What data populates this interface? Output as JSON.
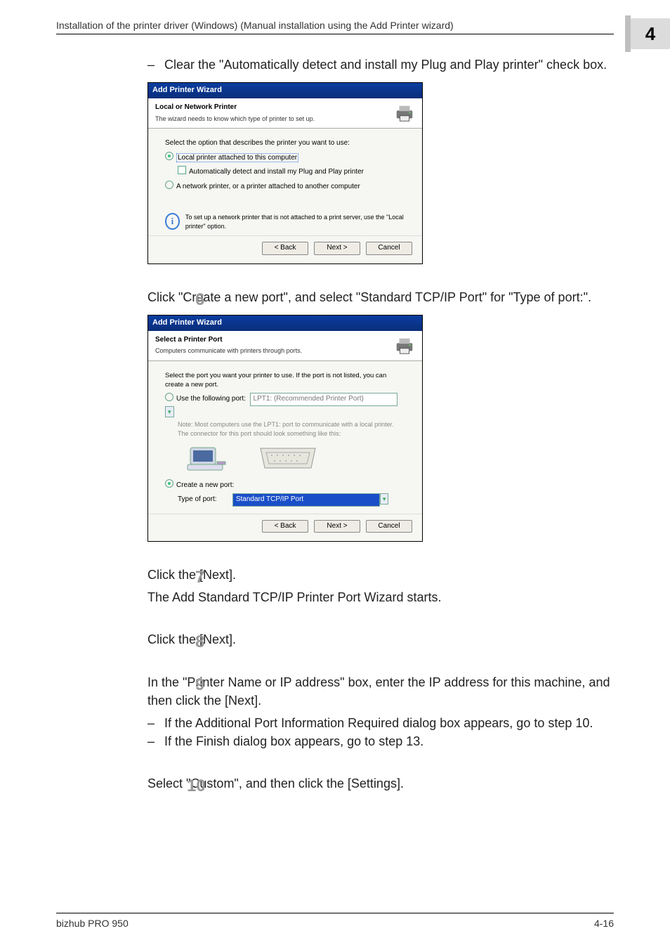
{
  "header": {
    "section_title": "Installation of the printer driver (Windows) (Manual installation using the Add Printer wizard)",
    "chapter_number": "4"
  },
  "step5": {
    "dash_text": "Clear the \"Automatically detect and install my Plug and Play printer\" check box."
  },
  "dlg1": {
    "window_title": "Add Printer Wizard",
    "heading": "Local or Network Printer",
    "subheading": "The wizard needs to know which type of printer to set up.",
    "prompt": "Select the option that describes the printer you want to use:",
    "opt_local": "Local printer attached to this computer",
    "chk_auto": "Automatically detect and install my Plug and Play printer",
    "opt_network": "A network printer, or a printer attached to another computer",
    "info_text": "To set up a network printer that is not attached to a print server, use the \"Local printer\" option.",
    "btn_back": "< Back",
    "btn_next": "Next >",
    "btn_cancel": "Cancel"
  },
  "step6": {
    "num": "6",
    "text": "Click \"Create a new port\", and select \"Standard TCP/IP Port\" for \"Type of port:\"."
  },
  "dlg2": {
    "window_title": "Add Printer Wizard",
    "heading": "Select a Printer Port",
    "subheading": "Computers communicate with printers through ports.",
    "prompt": "Select the port you want your printer to use.  If the port is not listed, you can create a new port.",
    "opt_use": "Use the following port:",
    "use_value": "LPT1: (Recommended Printer Port)",
    "note": "Note: Most computers use the LPT1: port to communicate with a local printer. The connector for this port should look something like this:",
    "opt_create": "Create a new port:",
    "type_label": "Type of port:",
    "type_value": "Standard TCP/IP Port",
    "btn_back": "< Back",
    "btn_next": "Next >",
    "btn_cancel": "Cancel"
  },
  "step7": {
    "num": "7",
    "text1": "Click the [Next].",
    "text2": "The Add Standard TCP/IP Printer Port Wizard starts."
  },
  "step8": {
    "num": "8",
    "text": "Click the [Next]."
  },
  "step9": {
    "num": "9",
    "text": "In the \"Printer Name or IP address\" box, enter the IP address for this machine, and then click the [Next].",
    "dash1": "If the Additional Port Information Required dialog box appears, go to step 10.",
    "dash2": "If the Finish dialog box appears, go to step 13."
  },
  "step10": {
    "num": "10",
    "text": "Select \"Custom\", and then click the [Settings]."
  },
  "footer": {
    "product": "bizhub PRO 950",
    "page": "4-16"
  }
}
